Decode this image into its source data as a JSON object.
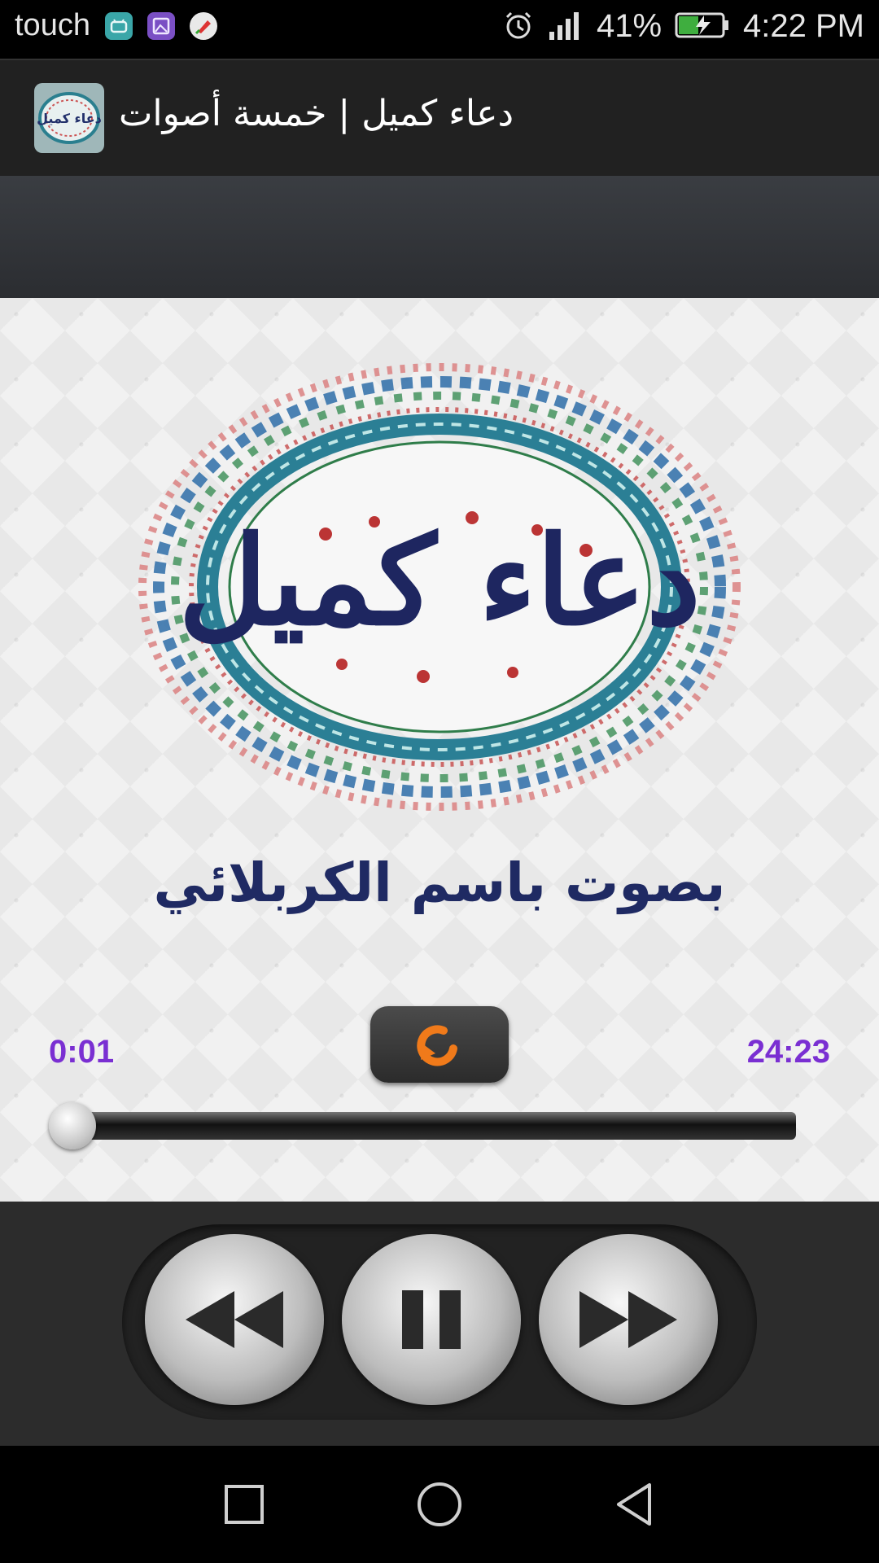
{
  "status_bar": {
    "carrier": "touch",
    "notification_icons": [
      "android-icon",
      "image-icon",
      "app-notification-icon"
    ],
    "system_icons": [
      "alarm-icon",
      "signal-icon",
      "battery-charging-icon"
    ],
    "battery": "41%",
    "time": "4:22 PM"
  },
  "app_bar": {
    "title": "دعاء كميل | خمسة أصوات",
    "icon_text": "دعاء كميل"
  },
  "player": {
    "artwork_title": "دعاء كميل",
    "reciter": "بصوت باسم الكربلائي",
    "elapsed": "0:01",
    "duration": "24:23",
    "progress_fraction": 0.001,
    "repeat_icon": "repeat-icon"
  },
  "controls": {
    "buttons": [
      "rewind-icon",
      "pause-icon",
      "fast-forward-icon"
    ]
  },
  "nav_bar": {
    "buttons": [
      "recents-icon",
      "home-icon",
      "back-icon"
    ]
  },
  "colors": {
    "time_text": "#7a2fd2",
    "reciter_text": "#1f2a63",
    "repeat_arrow": "#f07a1a"
  }
}
